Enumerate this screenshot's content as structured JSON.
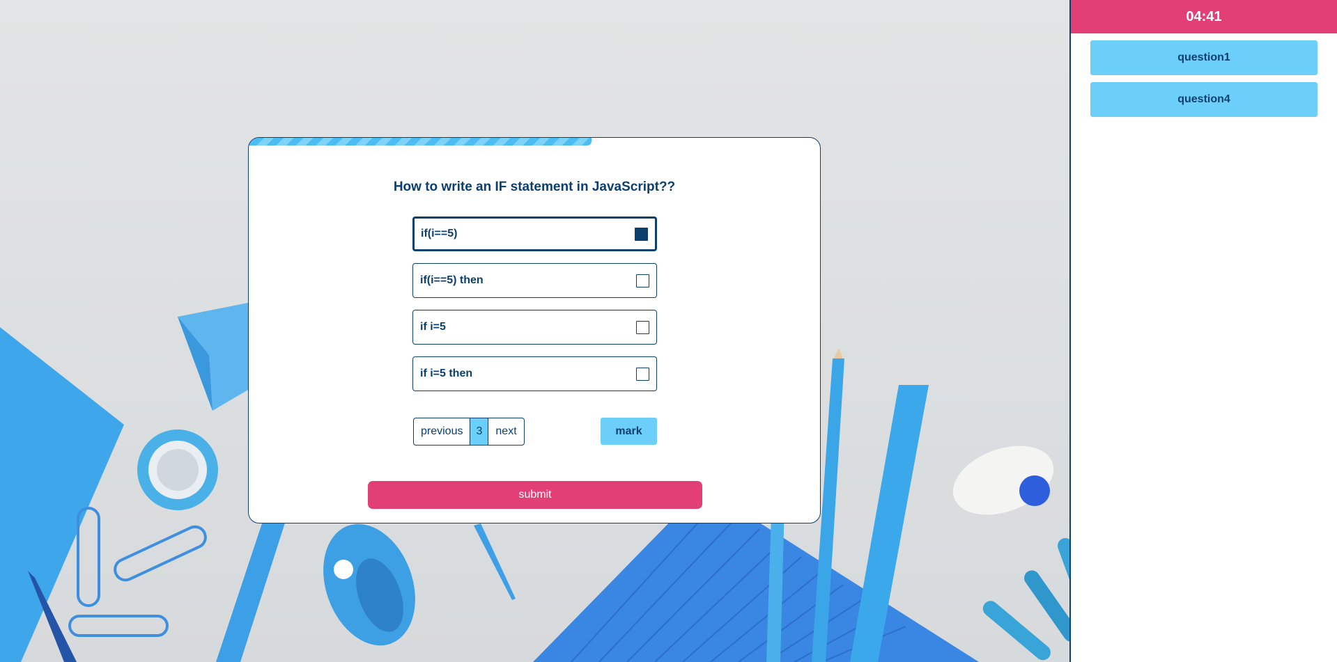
{
  "timer": {
    "value": "04:41"
  },
  "marked_questions": [
    {
      "label": "question1"
    },
    {
      "label": "question4"
    }
  ],
  "quiz": {
    "progress": 0.6,
    "question": "How to write an IF statement in JavaScript??",
    "options": [
      {
        "label": "if(i==5)",
        "checked": true
      },
      {
        "label": "if(i==5) then",
        "checked": false
      },
      {
        "label": "if i=5",
        "checked": false
      },
      {
        "label": "if i=5 then",
        "checked": false
      }
    ],
    "pager": {
      "previous_label": "previous",
      "current_page": "3",
      "next_label": "next"
    },
    "mark_label": "mark",
    "submit_label": "submit"
  },
  "colors": {
    "accent_pink": "#e23f77",
    "accent_blue": "#6ccffa",
    "navy": "#0b3f6e"
  },
  "icons": {
    "checkbox_checked": "checkbox-checked-icon",
    "checkbox_empty": "checkbox-icon"
  }
}
